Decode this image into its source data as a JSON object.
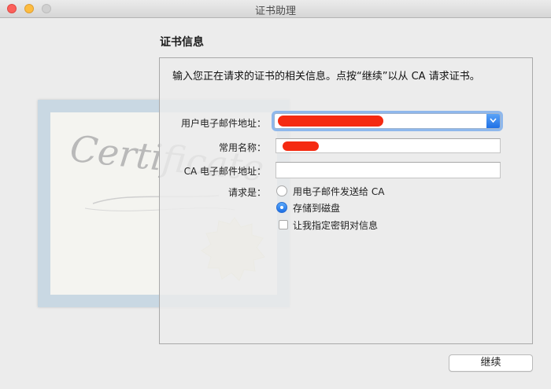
{
  "window": {
    "title": "证书助理"
  },
  "section": {
    "title": "证书信息",
    "intro": "输入您正在请求的证书的相关信息。点按“继续”以从 CA 请求证书。"
  },
  "form": {
    "email_label": "用户电子邮件地址：",
    "email_value": "",
    "common_name_label": "常用名称：",
    "common_name_value": "",
    "ca_email_label": "CA 电子邮件地址：",
    "ca_email_value": "",
    "request_label": "请求是：",
    "options": [
      {
        "label": "用电子邮件发送给 CA",
        "selected": false
      },
      {
        "label": "存储到磁盘",
        "selected": true
      }
    ],
    "checkbox_label": "让我指定密钥对信息",
    "checkbox_checked": false
  },
  "artwork": {
    "cert_script": "Certificate"
  },
  "buttons": {
    "continue_label": "继续"
  },
  "colors": {
    "accent": "#1e70e6",
    "redaction": "#f52a11"
  }
}
